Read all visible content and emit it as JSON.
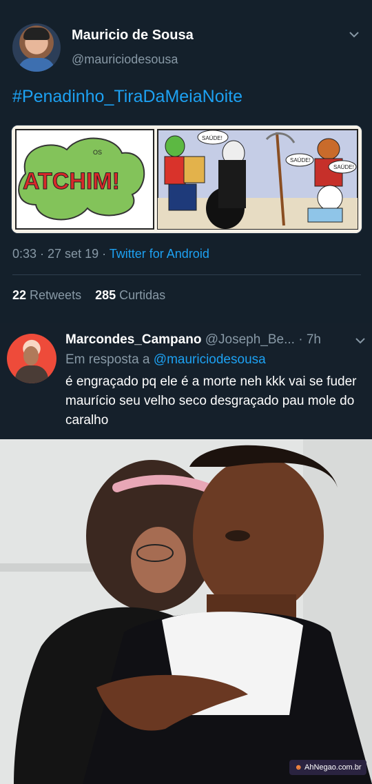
{
  "tweet": {
    "name": "Mauricio de Sousa",
    "handle": "@mauriciodesousa",
    "hashtag": "#Penadinho_TiraDaMeiaNoite",
    "comic": {
      "sfx": "ATCHIM!",
      "small_sfx": "OS",
      "bubble1": "SAÚDE!",
      "bubble2": "SAÚDE!",
      "bubble3": "SAÚDE!"
    },
    "meta": {
      "time": "0:33 · 27 set 19 · ",
      "client": "Twitter for Android"
    },
    "stats": {
      "retweets_count": "22",
      "retweets_label": " Retweets",
      "likes_count": "285",
      "likes_label": " Curtidas"
    }
  },
  "reply": {
    "name": "Marcondes_Campano",
    "handle": " @Joseph_Be... · 7h",
    "in_reply_prefix": "Em resposta a ",
    "in_reply_mention": "@mauriciodesousa",
    "text": "é engraçado pq ele é a morte neh kkk vai se fuder maurício seu velho seco desgraçado pau mole do caralho"
  },
  "watermark": "AhNegao.com.br",
  "icons": [
    "chevron-down-icon",
    "avatar",
    "comic-image",
    "meme-photo"
  ],
  "colors": {
    "background": "#15202b",
    "link": "#1da1f2",
    "muted": "#8899a6"
  }
}
